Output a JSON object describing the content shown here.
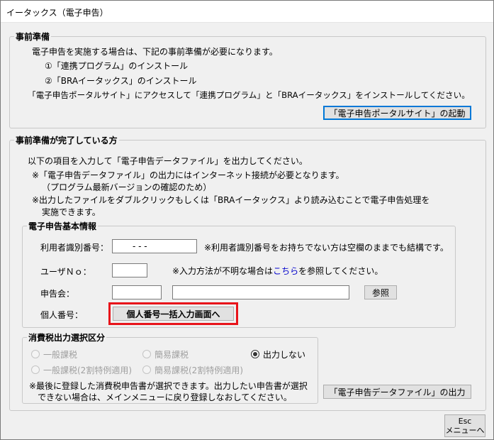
{
  "window": {
    "title": "イータックス（電子申告）"
  },
  "prep": {
    "legend": "事前準備",
    "line1": "電子申告を実施する場合は、下記の事前準備が必要になります。",
    "item1": "①「連携プログラム」のインストール",
    "item2": "②「BRAイータックス」のインストール",
    "line2": "「電子申告ポータルサイト」にアクセスして「連携プログラム」と「BRAイータックス」をインストールしてください。",
    "portal_button": "「電子申告ポータルサイト」の起動"
  },
  "done": {
    "legend": "事前準備が完了している方",
    "line1": "以下の項目を入力して「電子申告データファイル」を出力してください。",
    "note1a": "※「電子申告データファイル」の出力にはインターネット接続が必要となります。",
    "note1b": "（プログラム最新バージョンの確認のため）",
    "note2a": "※出力したファイルをダブルクリックもしくは「BRAイータックス」より読み込むことで電子申告処理を",
    "note2b": "実施できます。",
    "basic": {
      "legend": "電子申告基本情報",
      "userid_label": "利用者識別番号：",
      "userid_value": "-      -      -",
      "userid_note": "※利用者識別番号をお持ちでない方は空欄のままでも結構です。",
      "userno_label": "ユーザＮｏ：",
      "userno_note_pre": "※入力方法が不明な場合は",
      "userno_note_link": "こちら",
      "userno_note_post": "を参照してください。",
      "assoc_label": "申告会：",
      "browse_button": "参照",
      "mynumber_label": "個人番号：",
      "mynumber_button": "個人番号一括入力画面へ"
    },
    "tax": {
      "legend": "消費税出力選択区分",
      "opt1": "一般課税",
      "opt2": "簡易課税",
      "opt3": "出力しない",
      "opt4": "一般課税(2割特例適用)",
      "opt5": "簡易課税(2割特例適用)",
      "note_a": "※最後に登録した消費税申告書が選択できます。出力したい申告書が選択",
      "note_b": "できない場合は、メインメニューに戻り登録しなおしてください。"
    },
    "output_button": "「電子申告データファイル」の出力"
  },
  "esc": {
    "key": "Esc",
    "label": "メニューへ"
  },
  "colors": {
    "highlight": "#e8131a",
    "link": "#0000cc",
    "focus": "#0078d7"
  }
}
